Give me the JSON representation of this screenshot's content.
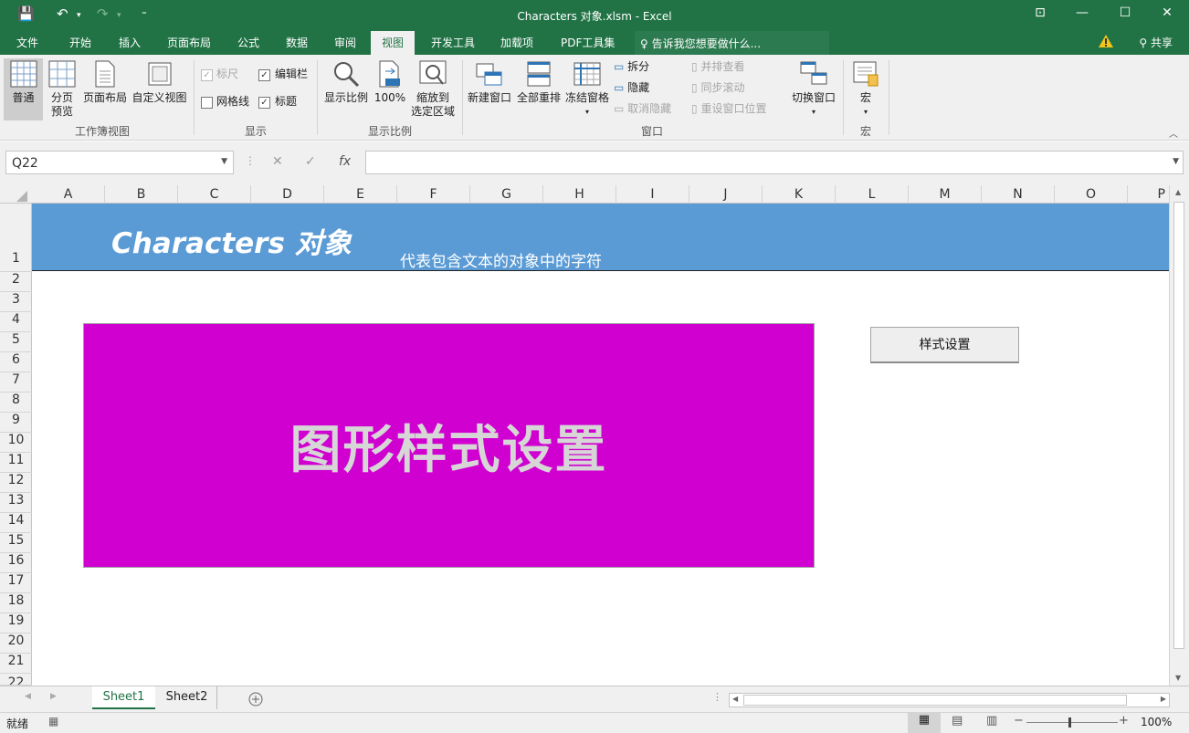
{
  "window": {
    "title": "Characters 对象.xlsm - Excel"
  },
  "quick_access": {
    "save": "💾",
    "undo": "↶",
    "redo": "↷",
    "customize": "⁼"
  },
  "tabs": [
    "文件",
    "开始",
    "插入",
    "页面布局",
    "公式",
    "数据",
    "审阅",
    "视图",
    "开发工具",
    "加载项",
    "PDF工具集"
  ],
  "active_tab": "视图",
  "tellme": "告诉我您想要做什么...",
  "share": "共享",
  "ribbon": {
    "workbook_views": {
      "normal": "普通",
      "page_break": "分页\n预览",
      "page_layout": "页面布局",
      "custom": "自定义视图",
      "group": "工作簿视图"
    },
    "show": {
      "ruler": "标尺",
      "formula_bar": "编辑栏",
      "gridlines": "网格线",
      "headings": "标题",
      "group": "显示"
    },
    "zoom": {
      "zoom": "显示比例",
      "hundred": "100%",
      "zoom_sel": "缩放到\n选定区域",
      "group": "显示比例"
    },
    "window": {
      "new": "新建窗口",
      "arrange": "全部重排",
      "freeze": "冻结窗格",
      "split": "拆分",
      "hide": "隐藏",
      "unhide": "取消隐藏",
      "side": "并排查看",
      "sync": "同步滚动",
      "reset": "重设窗口位置",
      "switch": "切换窗口",
      "group": "窗口"
    },
    "macros": {
      "macro": "宏",
      "group": "宏"
    }
  },
  "namebox": "Q22",
  "columns": [
    "A",
    "B",
    "C",
    "D",
    "E",
    "F",
    "G",
    "H",
    "I",
    "J",
    "K",
    "L",
    "M",
    "N",
    "O",
    "P"
  ],
  "rows": [
    "1",
    "2",
    "3",
    "4",
    "5",
    "6",
    "7",
    "8",
    "9",
    "10",
    "11",
    "12",
    "13",
    "14",
    "15",
    "16",
    "17",
    "18",
    "19",
    "20",
    "21",
    "22"
  ],
  "banner": {
    "title": "Characters 对象",
    "subtitle": "代表包含文本的对象中的字符"
  },
  "shape_text": "图形样式设置",
  "button_label": "样式设置",
  "sheets": [
    "Sheet1",
    "Sheet2"
  ],
  "status": {
    "ready": "就绪",
    "zoom": "100%"
  }
}
